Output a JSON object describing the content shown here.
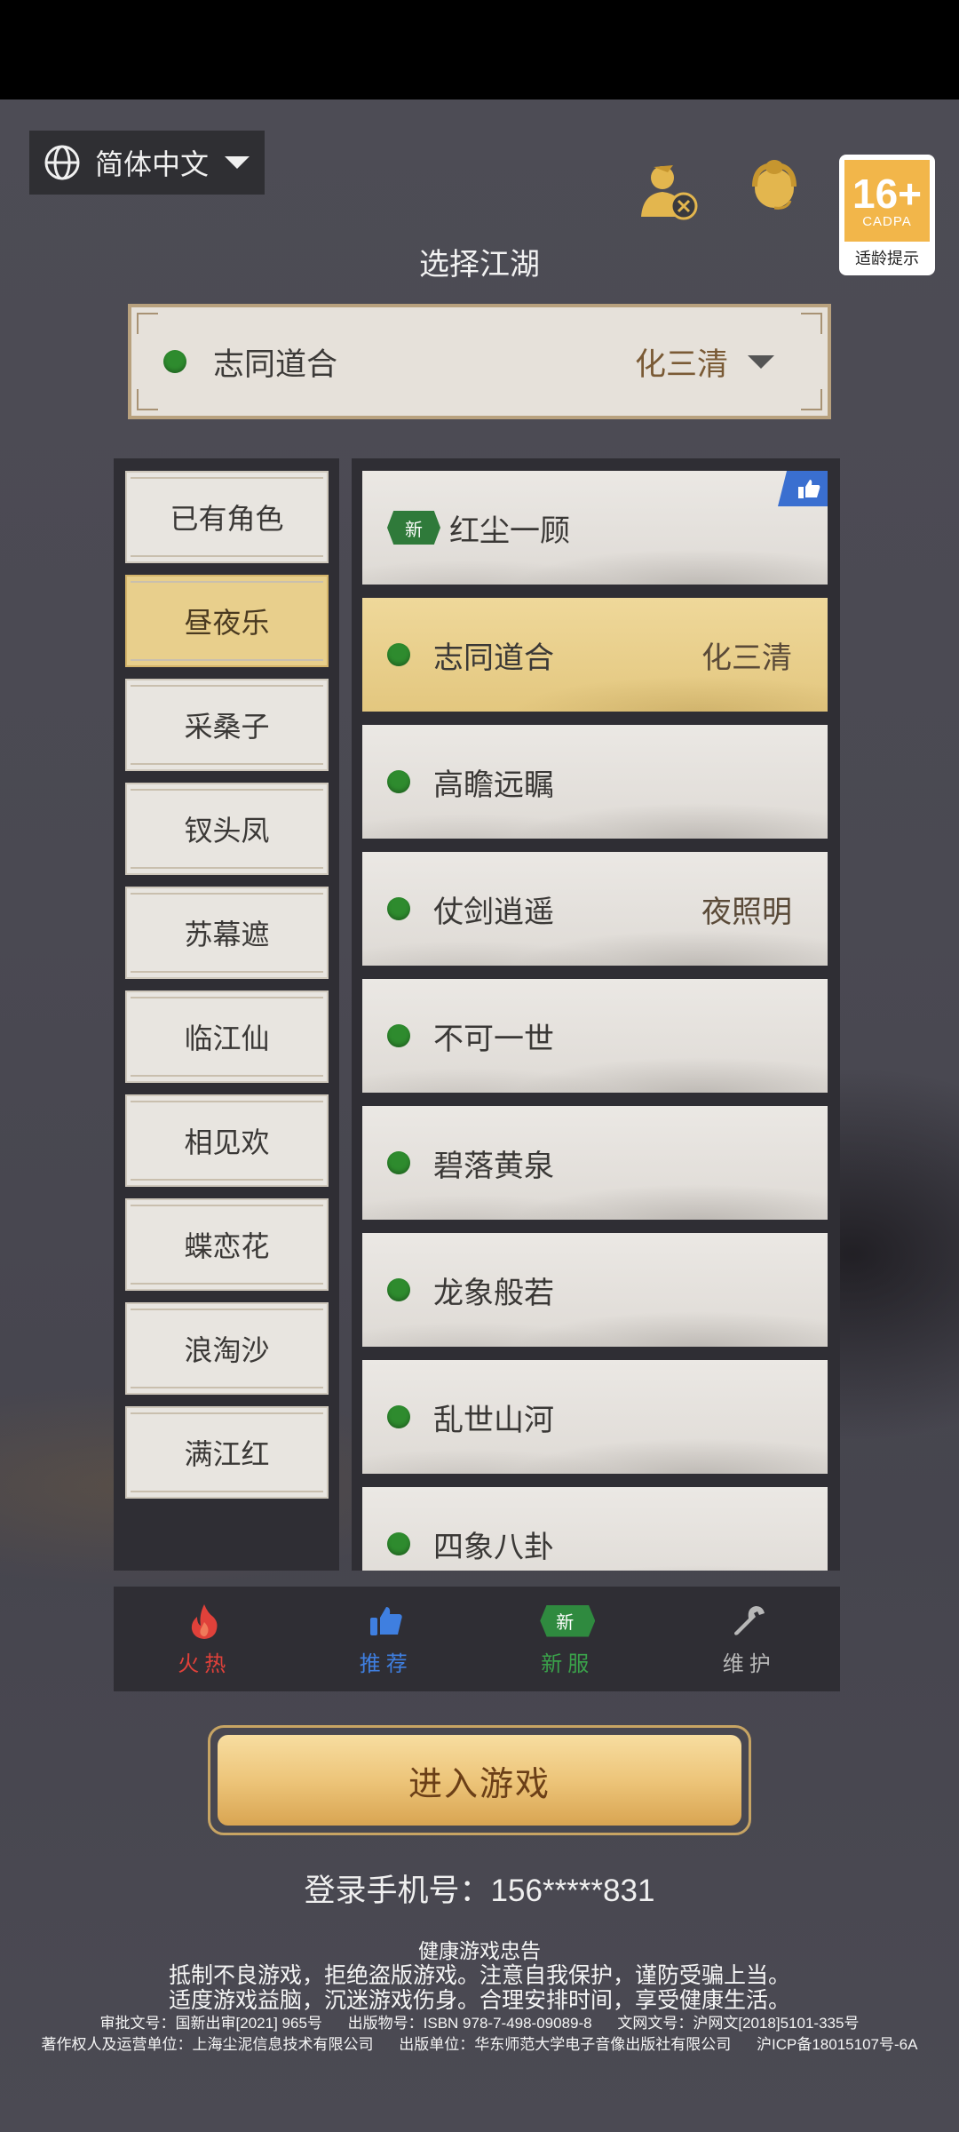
{
  "language": {
    "label": "简体中文",
    "icon": "globe-icon"
  },
  "top_icons": [
    "account-switch-icon",
    "customer-service-icon"
  ],
  "age_badge": {
    "rating": "16+",
    "org": "CADPA",
    "label": "适龄提示"
  },
  "title": "选择江湖",
  "current_server": {
    "name": "志同道合",
    "character": "化三清",
    "status_color": "#2e8b2e"
  },
  "categories": [
    "已有角色",
    "昼夜乐",
    "采桑子",
    "钗头凤",
    "苏幕遮",
    "临江仙",
    "相见欢",
    "蝶恋花",
    "浪淘沙",
    "满江红"
  ],
  "active_category": "昼夜乐",
  "servers": [
    {
      "name": "红尘一顾",
      "tag": "",
      "new_label": "新",
      "recommended": true
    },
    {
      "name": "志同道合",
      "tag": "化三清",
      "active": true
    },
    {
      "name": "高瞻远瞩",
      "tag": ""
    },
    {
      "name": "仗剑逍遥",
      "tag": "夜照明"
    },
    {
      "name": "不可一世",
      "tag": ""
    },
    {
      "name": "碧落黄泉",
      "tag": ""
    },
    {
      "name": "龙象般若",
      "tag": ""
    },
    {
      "name": "乱世山河",
      "tag": ""
    },
    {
      "name": "四象八卦",
      "tag": ""
    }
  ],
  "legend": {
    "hot": {
      "label": "火热",
      "color": "#e0413a",
      "icon": "fire-icon"
    },
    "recommend": {
      "label": "推荐",
      "color": "#3f7fe0",
      "icon": "thumbs-up-icon"
    },
    "new": {
      "label": "新服",
      "color": "#3aa14a",
      "badge": "新"
    },
    "maintenance": {
      "label": "维护",
      "color": "#b8b8b8",
      "icon": "wrench-icon"
    }
  },
  "enter_button": "进入游戏",
  "phone_line": "登录手机号：156*****831",
  "notice": {
    "heading": "健康游戏忠告",
    "line1": "抵制不良游戏，拒绝盗版游戏。注意自我保护，谨防受骗上当。",
    "line2": "适度游戏益脑，沉迷游戏伤身。合理安排时间，享受健康生活。",
    "approval": "审批文号：国新出审[2021] 965号",
    "publish_no": "出版物号：ISBN 978-7-498-09089-8",
    "culture_no": "文网文号：沪网文[2018]5101-335号",
    "operator": "著作权人及运营单位：上海尘泥信息技术有限公司",
    "publisher": "出版单位：华东师范大学电子音像出版社有限公司",
    "icp": "沪ICP备18015107号-6A"
  }
}
